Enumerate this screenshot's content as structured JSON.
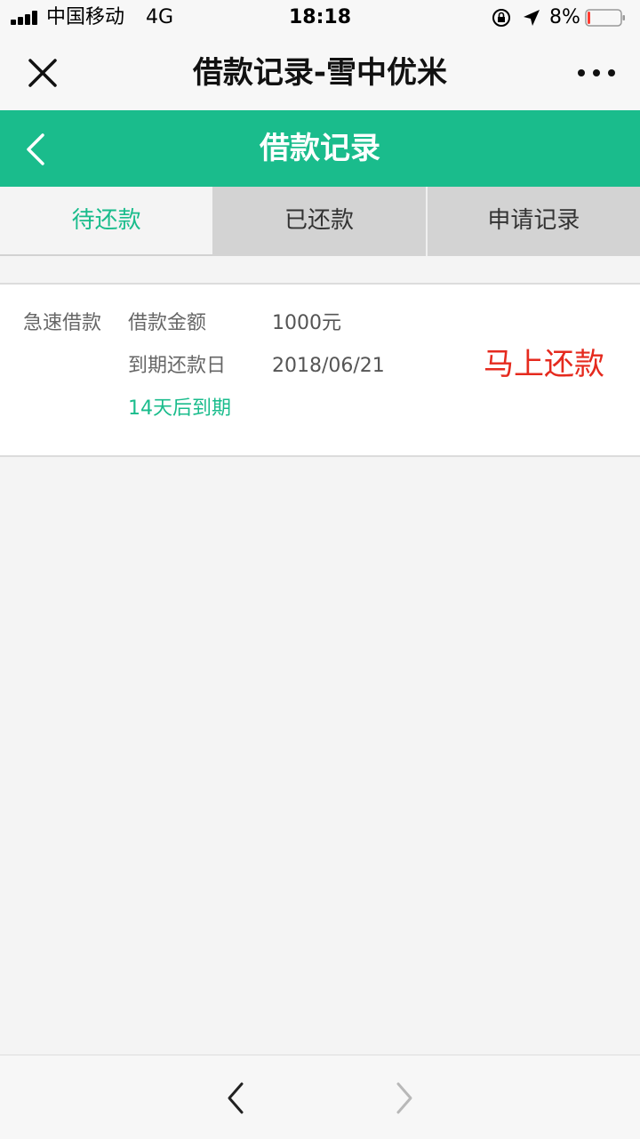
{
  "status_bar": {
    "carrier": "中国移动",
    "network": "4G",
    "time": "18:18",
    "battery_percent": "8%",
    "battery_level": 0.08,
    "battery_color": "#ff3b30"
  },
  "nav_bar": {
    "title": "借款记录-雪中优米",
    "close_icon": "close-icon",
    "more_icon": "more-dots-icon"
  },
  "header": {
    "title": "借款记录",
    "back_icon": "chevron-left-icon",
    "color": "#1abc8c"
  },
  "tabs": [
    {
      "label": "待还款",
      "active": true
    },
    {
      "label": "已还款",
      "active": false
    },
    {
      "label": "申请记录",
      "active": false
    }
  ],
  "loan": {
    "type": "急速借款",
    "amount_label": "借款金额",
    "amount_value": "1000元",
    "due_label": "到期还款日",
    "due_value": "2018/06/21",
    "due_note": "14天后到期",
    "action_label": "马上还款",
    "action_color": "#e52a1e"
  },
  "bottom_bar": {
    "back_icon": "chevron-left-icon",
    "forward_icon": "chevron-right-icon"
  }
}
